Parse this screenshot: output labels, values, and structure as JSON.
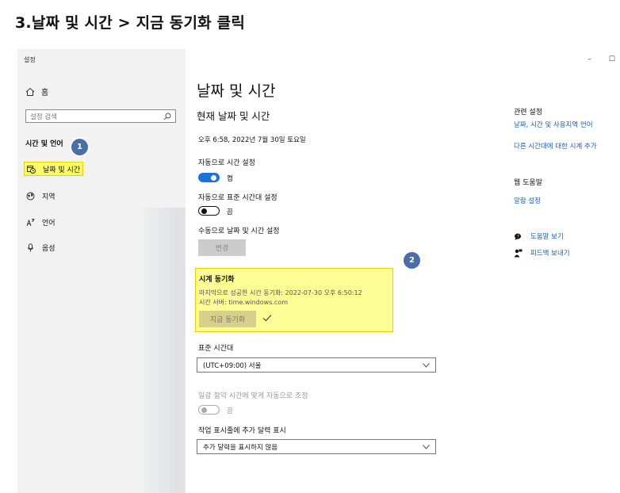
{
  "heading": "3.날짜 및 시간 > 지금 동기화 클릭",
  "window": {
    "title": "설정",
    "controls": {
      "minimize": "–",
      "maximize": "☐"
    }
  },
  "sidebar": {
    "home_label": "홈",
    "search_placeholder": "설정 검색",
    "section_label": "시간 및 언어",
    "items": [
      {
        "label": "날짜 및 시간",
        "icon": "calendar-clock-icon",
        "active": true
      },
      {
        "label": "지역",
        "icon": "globe-icon"
      },
      {
        "label": "언어",
        "icon": "language-icon"
      },
      {
        "label": "음성",
        "icon": "microphone-icon"
      }
    ]
  },
  "badges": {
    "first": "1",
    "second": "2"
  },
  "main": {
    "page_title": "날짜 및 시간",
    "sub_title": "현재 날짜 및 시간",
    "current_datetime": "오후 6:58, 2022년 7월 30일 토요일",
    "auto_time": {
      "label": "자동으로 시간 설정",
      "state": "켬"
    },
    "auto_timezone": {
      "label": "자동으로 표준 시간대 설정",
      "state": "끔"
    },
    "manual": {
      "label": "수동으로 날짜 및 시간 설정",
      "button": "변경"
    },
    "sync": {
      "title": "시계 동기화",
      "last_sync": "마지막으로 성공한 시간 동기화: 2022-07-30 오후 6:50:12",
      "server": "시간 서버: time.windows.com",
      "button": "지금 동기화"
    },
    "timezone": {
      "label": "표준 시간대",
      "value": "(UTC+09:00) 서울"
    },
    "dst": {
      "label": "일광 절약 시간에 맞게 자동으로 조정",
      "state": "끔"
    },
    "calendar": {
      "label": "작업 표시줄에 추가 달력 표시",
      "value": "추가 달력을 표시하지 않음"
    }
  },
  "related": {
    "heading": "관련 설정",
    "links": [
      "날짜, 시간 및 사용지역 언어",
      "다른 시간대에 대한 시계 추가"
    ],
    "help_heading": "웹 도움말",
    "help_link": "알람 설정",
    "help": "도움말 보기",
    "feedback": "피드백 보내기"
  },
  "colors": {
    "accent": "#1a73d6",
    "highlight": "#fdfd96",
    "badge": "#4a6fa8"
  }
}
